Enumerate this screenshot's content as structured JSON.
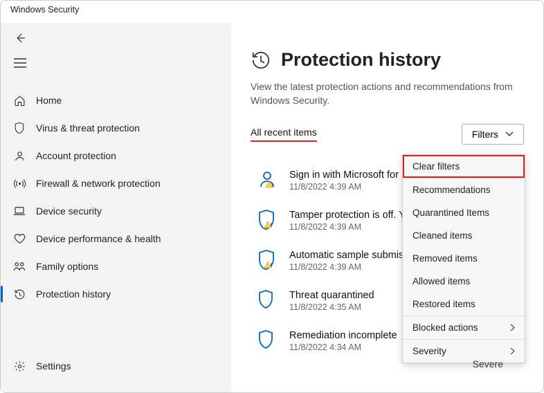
{
  "window": {
    "title": "Windows Security"
  },
  "sidebar": {
    "items": [
      {
        "label": "Home"
      },
      {
        "label": "Virus & threat protection"
      },
      {
        "label": "Account protection"
      },
      {
        "label": "Firewall & network protection"
      },
      {
        "label": "Device security"
      },
      {
        "label": "Device performance & health"
      },
      {
        "label": "Family options"
      },
      {
        "label": "Protection history"
      }
    ],
    "settings_label": "Settings"
  },
  "page": {
    "title": "Protection history",
    "subtitle": "View the latest protection actions and recommendations from Windows Security.",
    "all_recent": "All recent items",
    "filters_label": "Filters"
  },
  "items": [
    {
      "title": "Sign in with Microsoft for",
      "date": "11/8/2022 4:39 AM"
    },
    {
      "title": "Tamper protection is off. Y",
      "date": "11/8/2022 4:39 AM"
    },
    {
      "title": "Automatic sample submis",
      "date": "11/8/2022 4:39 AM"
    },
    {
      "title": "Threat quarantined",
      "date": "11/8/2022 4:35 AM"
    },
    {
      "title": "Remediation incomplete",
      "date": "11/8/2022 4:34 AM"
    }
  ],
  "menu": {
    "clear": "Clear filters",
    "opts": [
      "Recommendations",
      "Quarantined Items",
      "Cleaned items",
      "Removed items",
      "Allowed items",
      "Restored items"
    ],
    "blocked": "Blocked actions",
    "severity": "Severity"
  },
  "severe_label": "Severe"
}
